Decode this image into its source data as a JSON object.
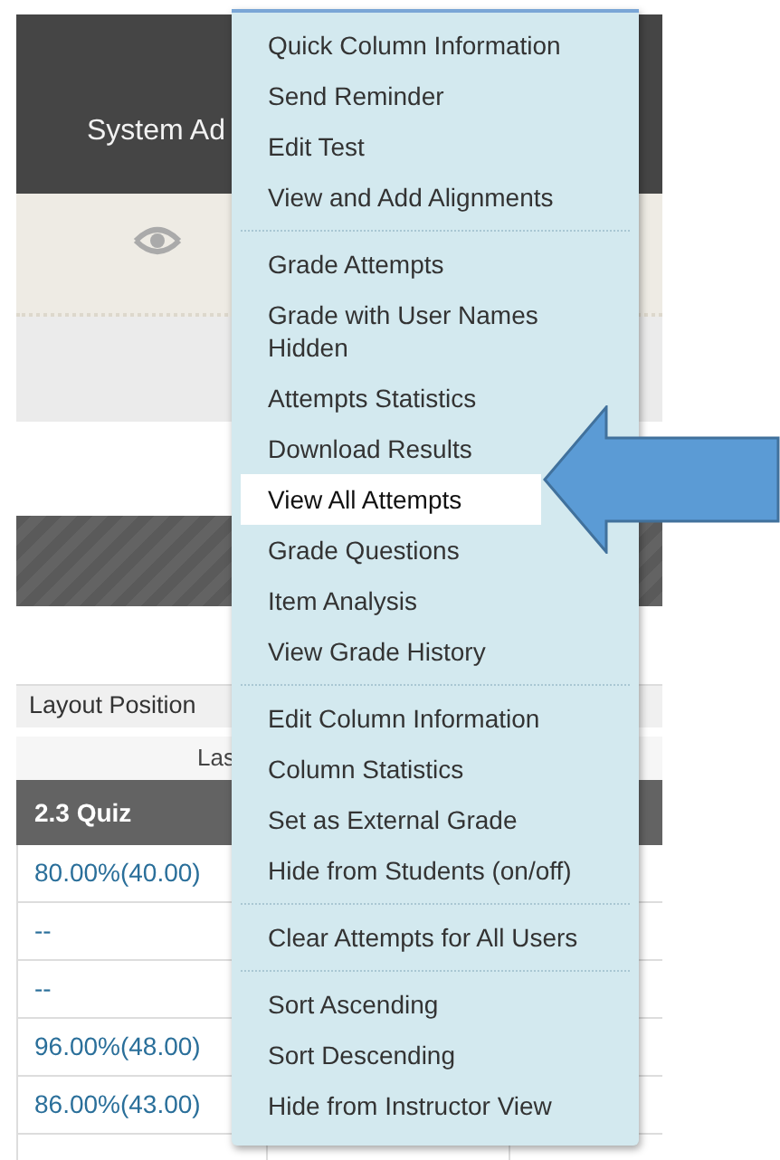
{
  "header": {
    "user_name": "System Ad"
  },
  "filter_bar": {
    "label": "Layout Position"
  },
  "table": {
    "group_heading": "Las",
    "columns": [
      "2.3 Quiz"
    ],
    "rows": [
      [
        "80.00%(40.00)"
      ],
      [
        "--"
      ],
      [
        "--"
      ],
      [
        "96.00%(48.00)"
      ],
      [
        "86.00%(43.00)"
      ],
      [
        ""
      ]
    ]
  },
  "menu": {
    "groups": [
      [
        {
          "label": "Quick Column Information",
          "selected": false
        },
        {
          "label": "Send Reminder",
          "selected": false
        },
        {
          "label": "Edit Test",
          "selected": false
        },
        {
          "label": "View and Add Alignments",
          "selected": false
        }
      ],
      [
        {
          "label": "Grade Attempts",
          "selected": false
        },
        {
          "label": "Grade with User Names Hidden",
          "selected": false
        },
        {
          "label": "Attempts Statistics",
          "selected": false
        },
        {
          "label": "Download Results",
          "selected": false
        },
        {
          "label": "View All Attempts",
          "selected": true
        },
        {
          "label": "Grade Questions",
          "selected": false
        },
        {
          "label": "Item Analysis",
          "selected": false
        },
        {
          "label": "View Grade History",
          "selected": false
        }
      ],
      [
        {
          "label": "Edit Column Information",
          "selected": false
        },
        {
          "label": "Column Statistics",
          "selected": false
        },
        {
          "label": "Set as External Grade",
          "selected": false
        },
        {
          "label": "Hide from Students (on/off)",
          "selected": false
        }
      ],
      [
        {
          "label": "Clear Attempts for All Users",
          "selected": false
        }
      ],
      [
        {
          "label": "Sort Ascending",
          "selected": false
        },
        {
          "label": "Sort Descending",
          "selected": false
        },
        {
          "label": "Hide from Instructor View",
          "selected": false
        }
      ]
    ]
  }
}
